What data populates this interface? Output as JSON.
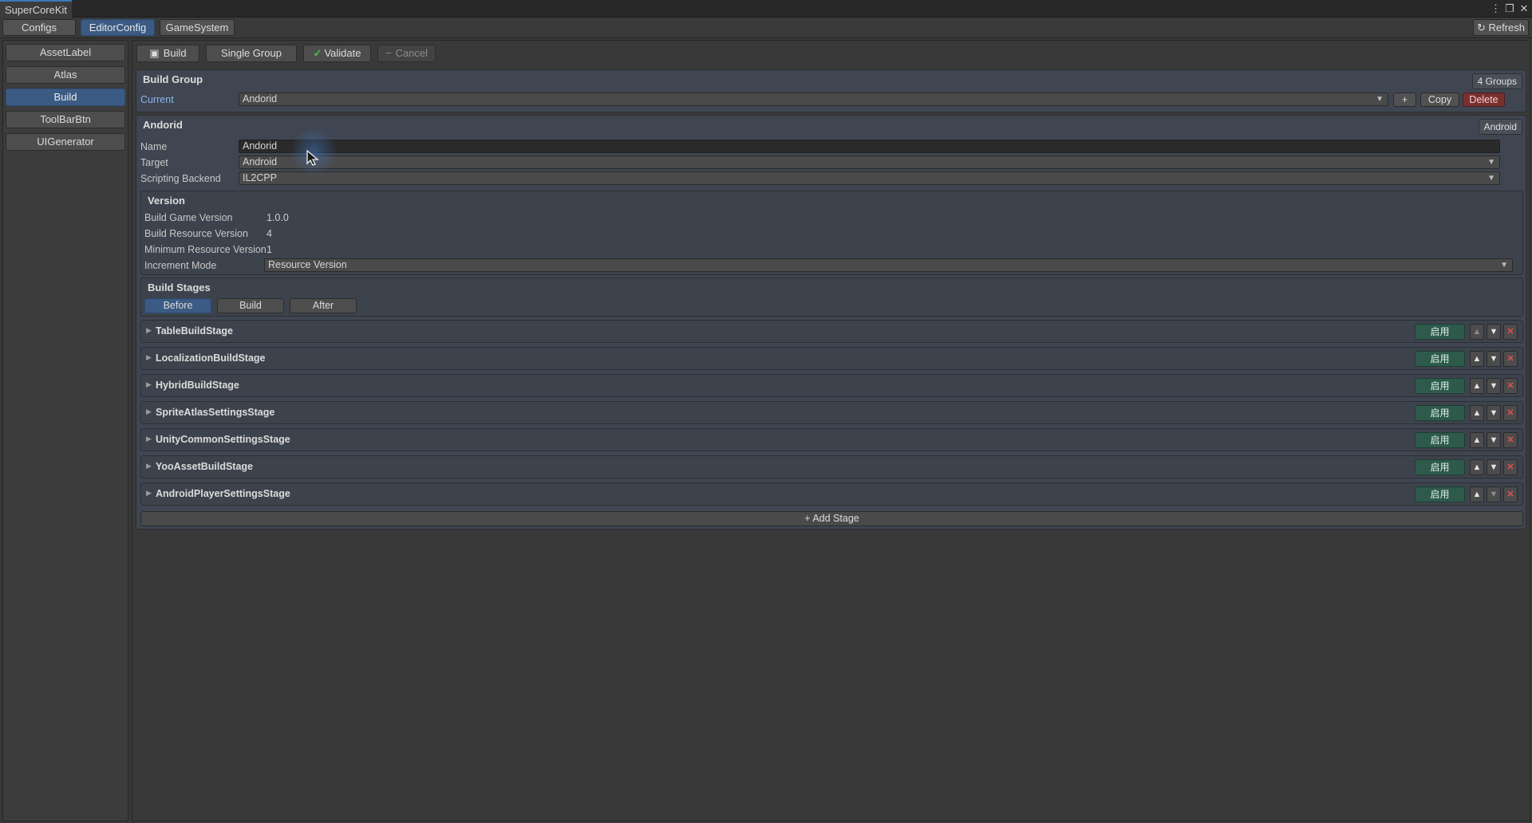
{
  "window": {
    "title": "SuperCoreKit",
    "controls": [
      "⋮",
      "❐",
      "✕"
    ]
  },
  "tabs": [
    {
      "label": "Configs",
      "active": false
    },
    {
      "label": "EditorConfig",
      "active": true
    },
    {
      "label": "GameSystem",
      "active": false
    }
  ],
  "refresh_label": "Refresh",
  "sidebar": {
    "items": [
      {
        "label": "AssetLabel",
        "active": false
      },
      {
        "label": "Atlas",
        "active": false
      },
      {
        "label": "Build",
        "active": true
      },
      {
        "label": "ToolBarBtn",
        "active": false
      },
      {
        "label": "UIGenerator",
        "active": false
      }
    ]
  },
  "toolbar": {
    "build": "Build",
    "single_group": "Single Group",
    "validate": "Validate",
    "cancel": "Cancel"
  },
  "build_group": {
    "heading": "Build Group",
    "count_badge": "4 Groups",
    "current_label": "Current",
    "current_value": "Andorid",
    "add_label": "+",
    "copy_label": "Copy",
    "delete_label": "Delete"
  },
  "group": {
    "heading": "Andorid",
    "platform_badge": "Android",
    "name_label": "Name",
    "name_value": "Andorid",
    "target_label": "Target",
    "target_value": "Android",
    "backend_label": "Scripting Backend",
    "backend_value": "IL2CPP"
  },
  "version": {
    "heading": "Version",
    "game_version_label": "Build Game Version",
    "game_version_value": "1.0.0",
    "resource_version_label": "Build Resource Version",
    "resource_version_value": "4",
    "min_resource_label": "Minimum Resource Version",
    "min_resource_value": "1",
    "increment_label": "Increment Mode",
    "increment_value": "Resource Version"
  },
  "build_stages": {
    "heading": "Build Stages",
    "tabs": [
      {
        "label": "Before",
        "active": true
      },
      {
        "label": "Build",
        "active": false
      },
      {
        "label": "After",
        "active": false
      }
    ],
    "stages": [
      {
        "name": "TableBuildStage",
        "enable_label": "启用",
        "up_enabled": false,
        "down_enabled": true
      },
      {
        "name": "LocalizationBuildStage",
        "enable_label": "启用",
        "up_enabled": true,
        "down_enabled": true
      },
      {
        "name": "HybridBuildStage",
        "enable_label": "启用",
        "up_enabled": true,
        "down_enabled": true
      },
      {
        "name": "SpriteAtlasSettingsStage",
        "enable_label": "启用",
        "up_enabled": true,
        "down_enabled": true
      },
      {
        "name": "UnityCommonSettingsStage",
        "enable_label": "启用",
        "up_enabled": true,
        "down_enabled": true
      },
      {
        "name": "YooAssetBuildStage",
        "enable_label": "启用",
        "up_enabled": true,
        "down_enabled": true
      },
      {
        "name": "AndroidPlayerSettingsStage",
        "enable_label": "启用",
        "up_enabled": true,
        "down_enabled": false
      }
    ],
    "add_label": "+ Add Stage"
  },
  "colors": {
    "accent_blue": "#3b5b84",
    "enable_green": "#2e5a4b",
    "delete_red": "#7a2f2f",
    "validate_check": "#43c24a"
  }
}
